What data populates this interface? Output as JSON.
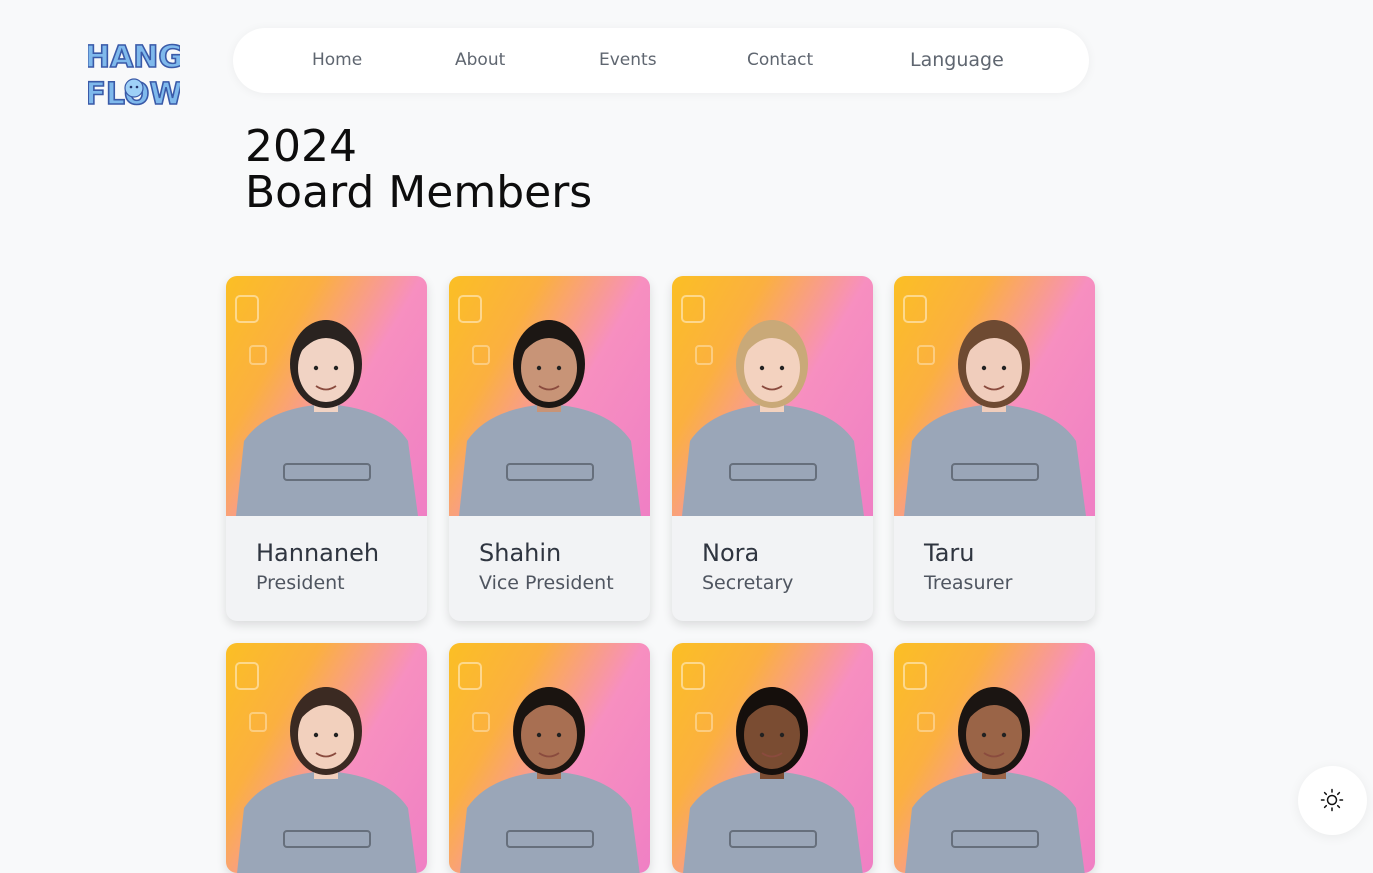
{
  "logo": {
    "line1": "HANG",
    "line2": "FLOW"
  },
  "nav": {
    "items": [
      {
        "label": "Home"
      },
      {
        "label": "About"
      },
      {
        "label": "Events"
      },
      {
        "label": "Contact"
      },
      {
        "label": "Language"
      }
    ]
  },
  "page": {
    "title_year": "2024",
    "title_text": "Board Members"
  },
  "members": [
    {
      "name": "Hannaneh",
      "role": "President"
    },
    {
      "name": "Shahin",
      "role": "Vice President"
    },
    {
      "name": "Nora",
      "role": "Secretary"
    },
    {
      "name": "Taru",
      "role": "Treasurer"
    },
    {
      "name": "",
      "role": ""
    },
    {
      "name": "",
      "role": ""
    },
    {
      "name": "",
      "role": ""
    },
    {
      "name": "",
      "role": ""
    }
  ],
  "theme_toggle": {
    "icon": "sun-icon"
  },
  "colors": {
    "background": "#f8f9fa",
    "nav_background": "#ffffff",
    "card_background": "#f2f3f5",
    "photo_gradient_start": "#fbbf24",
    "photo_gradient_end": "#ef7fc4",
    "sweater": "#9aa6b8"
  }
}
